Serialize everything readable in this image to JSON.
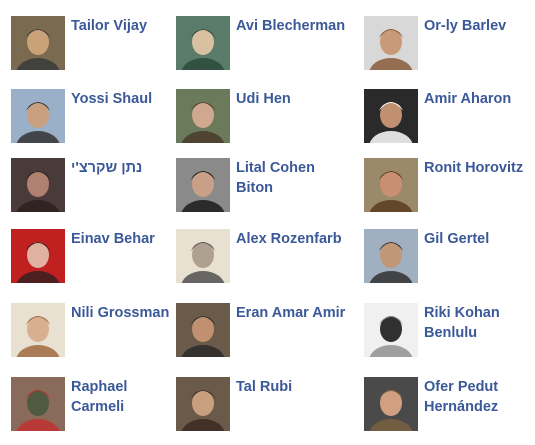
{
  "friends": [
    {
      "name": "Tailor Vijay",
      "photo": "avatar-photo"
    },
    {
      "name": "Avi Blecherman",
      "photo": "avatar-photo"
    },
    {
      "name": "Or-ly Barlev",
      "photo": "avatar-photo"
    },
    {
      "name": "Yossi Shaul",
      "photo": "avatar-photo"
    },
    {
      "name": "Udi Hen",
      "photo": "avatar-photo"
    },
    {
      "name": "Amir Aharon",
      "photo": "avatar-photo"
    },
    {
      "name": "נתן שקרצ'י",
      "photo": "avatar-photo"
    },
    {
      "name": "Lital Cohen Biton",
      "photo": "avatar-photo"
    },
    {
      "name": "Ronit Horovitz",
      "photo": "avatar-photo"
    },
    {
      "name": "Einav Behar",
      "photo": "avatar-photo"
    },
    {
      "name": "Alex Rozenfarb",
      "photo": "avatar-photo"
    },
    {
      "name": "Gil Gertel",
      "photo": "avatar-photo"
    },
    {
      "name": "Nili Grossman",
      "photo": "avatar-photo"
    },
    {
      "name": "Eran Amar Amir",
      "photo": "avatar-photo"
    },
    {
      "name": "Riki Kohan Benlulu",
      "photo": "avatar-photo"
    },
    {
      "name": "Raphael Carmeli",
      "photo": "avatar-photo"
    },
    {
      "name": "Tal Rubi",
      "photo": "avatar-photo"
    },
    {
      "name": "Ofer Pedut Hernández",
      "photo": "avatar-photo"
    }
  ],
  "colors": {
    "link": "#3b5998",
    "background": "#ffffff"
  }
}
